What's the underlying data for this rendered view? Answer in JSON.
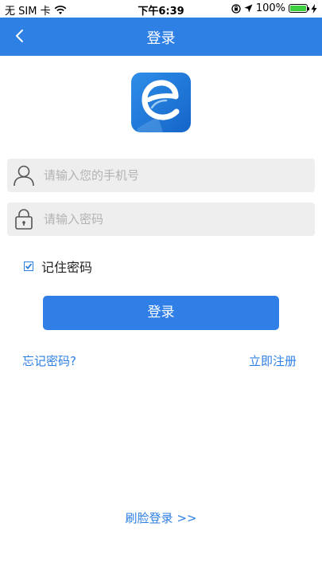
{
  "status_bar": {
    "carrier": "无 SIM 卡",
    "time": "下午6:39",
    "battery": "100%",
    "icons": [
      "wifi-icon",
      "orientation-lock-icon",
      "location-arrow-icon",
      "battery-icon",
      "charging-bolt-icon"
    ]
  },
  "nav": {
    "title": "登录",
    "back_icon": "chevron-left-icon"
  },
  "logo": {
    "icon": "app-logo-e"
  },
  "form": {
    "phone_placeholder": "请输入您的手机号",
    "phone_value": "",
    "password_placeholder": "请输入密码",
    "password_value": "",
    "remember_label": "记住密码",
    "remember_checked": true,
    "login_button": "登录"
  },
  "links": {
    "forgot": "忘记密码?",
    "register": "立即注册",
    "face_login": "刷脸登录 >>"
  },
  "colors": {
    "primary": "#2f80e4",
    "field_bg": "#eeeeee",
    "placeholder": "#b3b3b3"
  }
}
